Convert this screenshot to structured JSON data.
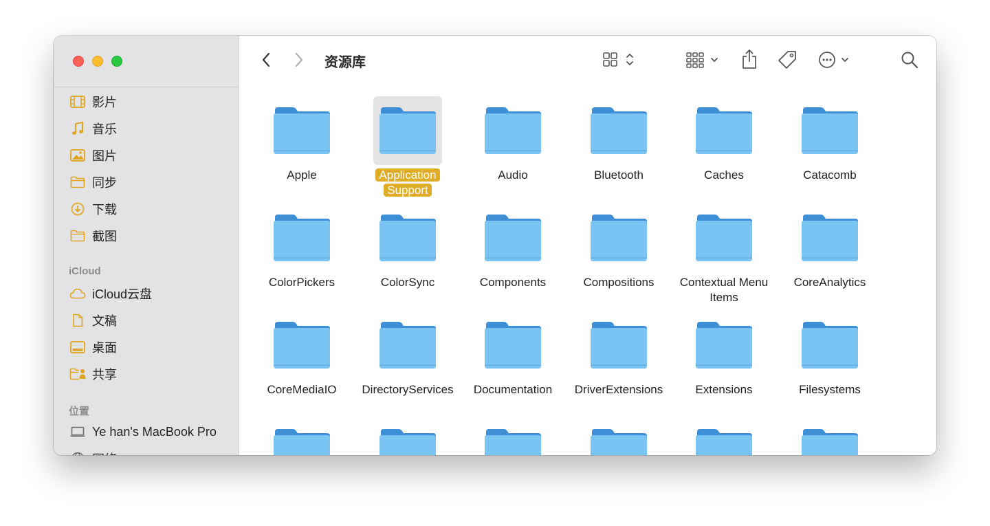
{
  "window": {
    "title": "资源库"
  },
  "sidebar": {
    "items": [
      {
        "label": "影片",
        "icon": "film-icon"
      },
      {
        "label": "音乐",
        "icon": "music-note-icon"
      },
      {
        "label": "图片",
        "icon": "photo-icon"
      },
      {
        "label": "同步",
        "icon": "folder-icon"
      },
      {
        "label": "下载",
        "icon": "download-circle-icon"
      },
      {
        "label": "截图",
        "icon": "folder-icon"
      }
    ],
    "icloud_header": "iCloud",
    "icloud_items": [
      {
        "label": "iCloud云盘",
        "icon": "cloud-icon"
      },
      {
        "label": "文稿",
        "icon": "document-icon"
      },
      {
        "label": "桌面",
        "icon": "desktop-icon"
      },
      {
        "label": "共享",
        "icon": "shared-folder-icon"
      }
    ],
    "locations_header": "位置",
    "location_items": [
      {
        "label": "Ye han's MacBook Pro",
        "icon": "laptop-icon"
      },
      {
        "label": "网络",
        "icon": "globe-icon"
      }
    ],
    "accent_color": "#e0a520"
  },
  "toolbar": {
    "back_icon": "chevron-left-icon",
    "forward_icon": "chevron-right-icon",
    "view_icon": "icon-grid-view-icon",
    "group_icon": "group-by-icon",
    "share_icon": "share-icon",
    "tag_icon": "tag-icon",
    "more_icon": "ellipsis-circle-icon",
    "search_icon": "search-icon"
  },
  "folders": {
    "row1": [
      {
        "name": "Apple"
      },
      {
        "name": "Application Support",
        "selected": true
      },
      {
        "name": "Audio"
      },
      {
        "name": "Bluetooth"
      },
      {
        "name": "Caches"
      },
      {
        "name": "Catacomb"
      }
    ],
    "row2": [
      {
        "name": "ColorPickers"
      },
      {
        "name": "ColorSync"
      },
      {
        "name": "Components"
      },
      {
        "name": "Compositions"
      },
      {
        "name": "Contextual Menu Items"
      },
      {
        "name": "CoreAnalytics"
      }
    ],
    "row3": [
      {
        "name": "CoreMediaIO"
      },
      {
        "name": "DirectoryServices"
      },
      {
        "name": "Documentation"
      },
      {
        "name": "DriverExtensions"
      },
      {
        "name": "Extensions"
      },
      {
        "name": "Filesystems"
      }
    ],
    "selection_color": "#dfac26",
    "folder_color": "#76c0f0"
  }
}
